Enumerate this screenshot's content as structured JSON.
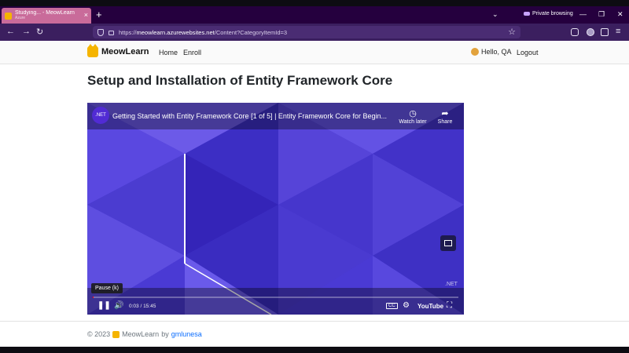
{
  "browser": {
    "tab": {
      "title": "Studying... - MeowLearn",
      "subtitle": "Azure",
      "close": "×"
    },
    "new_tab": "+",
    "tab_list": "⌄",
    "private_label": "Private browsing",
    "window_controls": {
      "minimize": "—",
      "restore": "❐",
      "close": "✕"
    },
    "nav": {
      "back": "←",
      "forward": "→",
      "reload": "↻"
    },
    "url": {
      "prefix": "https://",
      "host": "meowlearn.azurewebsites.net",
      "path": "/Content?CategoryItemId=3"
    },
    "bookmark": "☆",
    "menu": "≡"
  },
  "site": {
    "brand": "MeowLearn",
    "nav": {
      "home": "Home",
      "enroll": "Enroll"
    },
    "greeting": "Hello, QA",
    "logout": "Logout"
  },
  "main": {
    "title": "Setup and Installation of Entity Framework Core",
    "video": {
      "channel_badge": ".NET",
      "title": "Getting Started with Entity Framework Core [1 of 5] | Entity Framework Core for Begin...",
      "watch_later": "Watch later",
      "share": "Share",
      "watermark": ".NET",
      "tooltip": "Pause (k)",
      "time": "0:03 / 15:45",
      "progress": 0.003,
      "logo": "YouTube",
      "cc": "CC",
      "settings_icon": "gear-icon"
    }
  },
  "footer": {
    "copyright": "© 2023",
    "brand": "MeowLearn",
    "by": "by",
    "author": "gmlunesa"
  }
}
